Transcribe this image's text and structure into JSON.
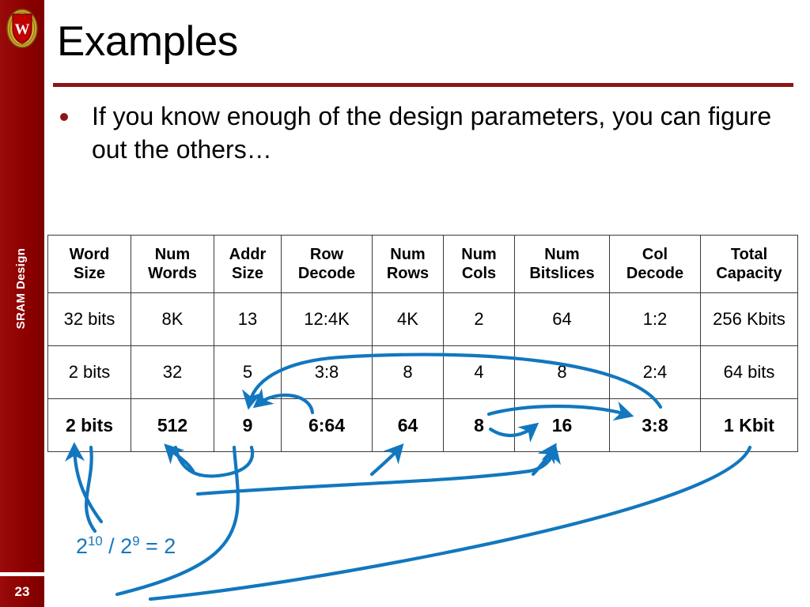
{
  "slide": {
    "title": "Examples",
    "number": "23",
    "sidebar_label": "SRAM Design",
    "bullet": "If you know enough of the design parameters, you can figure out the others…",
    "colors": {
      "brand_maroon": "#8C0000",
      "title_rule": "#8C1515",
      "highlight_red": "#C00000",
      "arrow_blue": "#1277BE",
      "text_black": "#000000"
    }
  },
  "table": {
    "headers": [
      {
        "line1": "Word",
        "line2": "Size"
      },
      {
        "line1": "Num",
        "line2": "Words"
      },
      {
        "line1": "Addr",
        "line2": "Size"
      },
      {
        "line1": "Row",
        "line2": "Decode"
      },
      {
        "line1": "Num",
        "line2": "Rows"
      },
      {
        "line1": "Num",
        "line2": "Cols"
      },
      {
        "line1": "Num",
        "line2": "Bitslices"
      },
      {
        "line1": "Col",
        "line2": "Decode"
      },
      {
        "line1": "Total",
        "line2": "Capacity"
      }
    ],
    "rows": [
      {
        "highlighted": false,
        "cells": [
          {
            "text": "32 bits",
            "emphasis": false
          },
          {
            "text": "8K",
            "emphasis": false
          },
          {
            "text": "13",
            "emphasis": false
          },
          {
            "text": "12:4K",
            "emphasis": false
          },
          {
            "text": "4K",
            "emphasis": false
          },
          {
            "text": "2",
            "emphasis": false
          },
          {
            "text": "64",
            "emphasis": false
          },
          {
            "text": "1:2",
            "emphasis": false
          },
          {
            "text": "256 Kbits",
            "emphasis": false
          }
        ]
      },
      {
        "highlighted": false,
        "cells": [
          {
            "text": "2 bits",
            "emphasis": false
          },
          {
            "text": "32",
            "emphasis": false
          },
          {
            "text": "5",
            "emphasis": false
          },
          {
            "text": "3:8",
            "emphasis": false
          },
          {
            "text": "8",
            "emphasis": false
          },
          {
            "text": "4",
            "emphasis": false
          },
          {
            "text": "8",
            "emphasis": false
          },
          {
            "text": "2:4",
            "emphasis": false
          },
          {
            "text": "64 bits",
            "emphasis": false
          }
        ]
      },
      {
        "highlighted": true,
        "cells": [
          {
            "text": "2 bits",
            "emphasis": true
          },
          {
            "text": "512",
            "emphasis": true
          },
          {
            "text": "9",
            "emphasis": true
          },
          {
            "text": "6:64",
            "emphasis": false
          },
          {
            "text": "64",
            "emphasis": true
          },
          {
            "text": "8",
            "emphasis": false
          },
          {
            "text": "16",
            "emphasis": true
          },
          {
            "text": "3:8",
            "emphasis": true
          },
          {
            "text": "1 Kbit",
            "emphasis": false
          }
        ]
      }
    ]
  },
  "annotations": {
    "formula_base1": "2",
    "formula_exp1": "10",
    "formula_divider": " / ",
    "formula_base2": "2",
    "formula_exp2": "9",
    "formula_equals": " = 2"
  },
  "chart_data": {
    "type": "table",
    "title": "SRAM design parameter examples",
    "columns": [
      "Word Size",
      "Num Words",
      "Addr Size",
      "Row Decode",
      "Num Rows",
      "Num Cols",
      "Num Bitslices",
      "Col Decode",
      "Total Capacity"
    ],
    "rows": [
      [
        "32 bits",
        "8K",
        "13",
        "12:4K",
        "4K",
        "2",
        "64",
        "1:2",
        "256 Kbits"
      ],
      [
        "2 bits",
        "32",
        "5",
        "3:8",
        "8",
        "4",
        "8",
        "2:4",
        "64 bits"
      ],
      [
        "2 bits",
        "512",
        "9",
        "6:64",
        "64",
        "8",
        "16",
        "3:8",
        "1 Kbit"
      ]
    ],
    "emphasized_cells": [
      [
        2,
        0
      ],
      [
        2,
        1
      ],
      [
        2,
        2
      ],
      [
        2,
        4
      ],
      [
        2,
        6
      ],
      [
        2,
        7
      ]
    ],
    "annotation": "2^10 / 2^9 = 2"
  }
}
